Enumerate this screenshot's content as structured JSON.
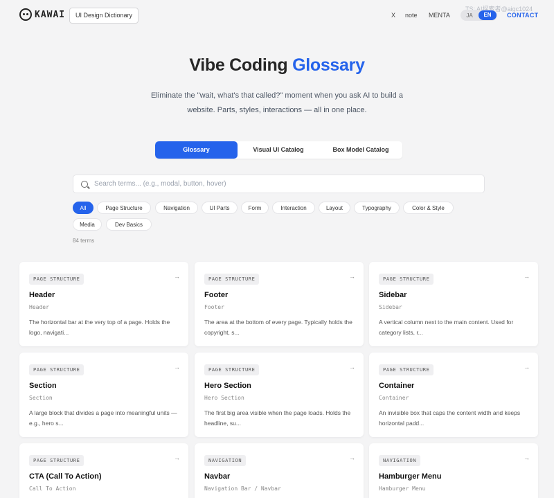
{
  "header": {
    "logo_text": "KAWAI",
    "dict_badge": "UI Design Dictionary",
    "nav_x": "X",
    "nav_note": "note",
    "nav_menta": "MENTA",
    "lang_ja": "JA",
    "lang_en": "EN",
    "contact": "CONTACT",
    "watermark": "TS: AI探索者@aigc1024"
  },
  "hero": {
    "title_main": "Vibe Coding ",
    "title_accent": "Glossary",
    "subtitle": "Eliminate the \"wait, what's that called?\" moment when you ask AI to build a website. Parts, styles, interactions — all in one place."
  },
  "tabs": [
    {
      "label": "Glossary"
    },
    {
      "label": "Visual UI Catalog"
    },
    {
      "label": "Box Model Catalog"
    }
  ],
  "search": {
    "placeholder": "Search terms... (e.g., modal, button, hover)"
  },
  "filters": [
    {
      "label": "All"
    },
    {
      "label": "Page Structure"
    },
    {
      "label": "Navigation"
    },
    {
      "label": "UI Parts"
    },
    {
      "label": "Form"
    },
    {
      "label": "Interaction"
    },
    {
      "label": "Layout"
    },
    {
      "label": "Typography"
    },
    {
      "label": "Color & Style"
    },
    {
      "label": "Media"
    },
    {
      "label": "Dev Basics"
    }
  ],
  "term_count": "84 terms",
  "cards": [
    {
      "tag": "PAGE STRUCTURE",
      "title": "Header",
      "sub": "Header",
      "desc": "The horizontal bar at the very top of a page. Holds the logo, navigati..."
    },
    {
      "tag": "PAGE STRUCTURE",
      "title": "Footer",
      "sub": "Footer",
      "desc": "The area at the bottom of every page. Typically holds the copyright, s..."
    },
    {
      "tag": "PAGE STRUCTURE",
      "title": "Sidebar",
      "sub": "Sidebar",
      "desc": "A vertical column next to the main content. Used for category lists, r..."
    },
    {
      "tag": "PAGE STRUCTURE",
      "title": "Section",
      "sub": "Section",
      "desc": "A large block that divides a page into meaningful units — e.g., hero s..."
    },
    {
      "tag": "PAGE STRUCTURE",
      "title": "Hero Section",
      "sub": "Hero Section",
      "desc": "The first big area visible when the page loads. Holds the headline, su..."
    },
    {
      "tag": "PAGE STRUCTURE",
      "title": "Container",
      "sub": "Container",
      "desc": "An invisible box that caps the content width and keeps horizontal padd..."
    },
    {
      "tag": "PAGE STRUCTURE",
      "title": "CTA (Call To Action)",
      "sub": "Call To Action",
      "desc": ""
    },
    {
      "tag": "NAVIGATION",
      "title": "Navbar",
      "sub": "Navigation Bar / Navbar",
      "desc": ""
    },
    {
      "tag": "NAVIGATION",
      "title": "Hamburger Menu",
      "sub": "Hamburger Menu",
      "desc": ""
    }
  ]
}
